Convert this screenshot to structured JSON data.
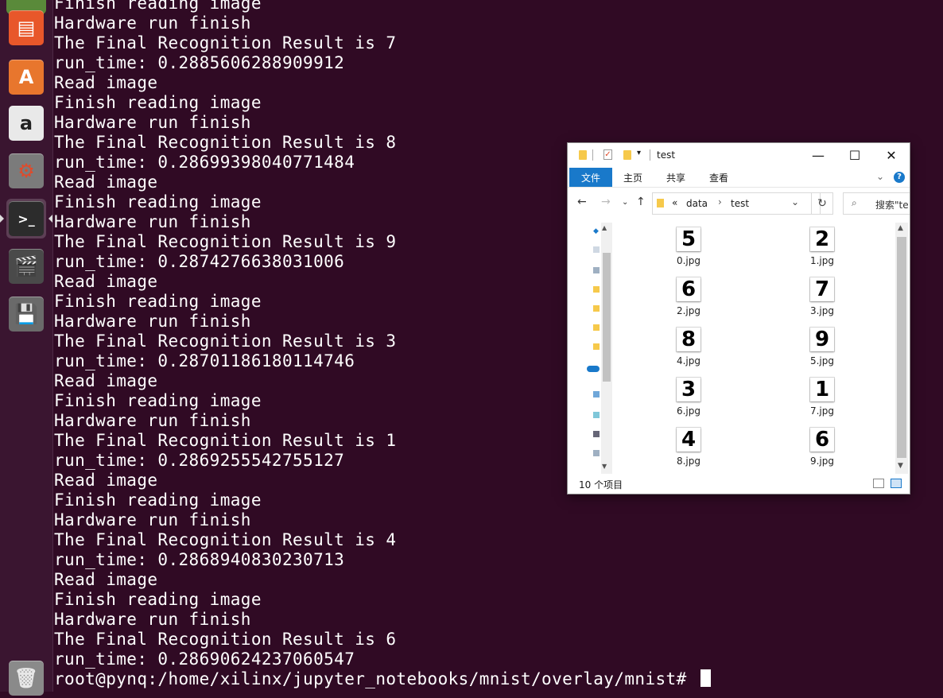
{
  "terminal": {
    "lines": [
      "Finish reading image",
      "Hardware run finish",
      "The Final Recognition Result is 7",
      "run_time: 0.2885606288909912",
      "Read image",
      "Finish reading image",
      "Hardware run finish",
      "The Final Recognition Result is 8",
      "run_time: 0.28699398040771484",
      "Read image",
      "Finish reading image",
      "Hardware run finish",
      "The Final Recognition Result is 9",
      "run_time: 0.2874276638031006",
      "Read image",
      "Finish reading image",
      "Hardware run finish",
      "The Final Recognition Result is 3",
      "run_time: 0.28701186180114746",
      "Read image",
      "Finish reading image",
      "Hardware run finish",
      "The Final Recognition Result is 1",
      "run_time: 0.2869255542755127",
      "Read image",
      "Finish reading image",
      "Hardware run finish",
      "The Final Recognition Result is 4",
      "run_time: 0.2868940830230713",
      "Read image",
      "Finish reading image",
      "Hardware run finish",
      "The Final Recognition Result is 6",
      "run_time: 0.28690624237060547"
    ],
    "prompt": "root@pynq:/home/xilinx/jupyter_notebooks/mnist/overlay/mnist# "
  },
  "launcher": {
    "items": [
      {
        "name": "presentation-app-icon",
        "glyph": "▤",
        "bg": "#e8572a",
        "fg": "#ffffff"
      },
      {
        "name": "software-center-icon",
        "glyph": "A",
        "bg": "#e8762d",
        "fg": "#ffffff"
      },
      {
        "name": "amazon-icon",
        "glyph": "a",
        "bg": "#e9e9e9",
        "fg": "#222222"
      },
      {
        "name": "system-settings-icon",
        "glyph": "⚙",
        "bg": "#7b7b7b",
        "fg": "#e04a2a"
      },
      {
        "name": "terminal-icon",
        "glyph": ">_",
        "bg": "#2c2c2c",
        "fg": "#ffffff"
      },
      {
        "name": "video-editor-icon",
        "glyph": "🎬",
        "bg": "#4a4a4a",
        "fg": "#ffffff"
      },
      {
        "name": "save-disk-icon",
        "glyph": "💾",
        "bg": "#6a6a6a",
        "fg": "#ffffff"
      }
    ],
    "trash_glyph": "🗑"
  },
  "explorer": {
    "title": "test",
    "ribbon_tabs": [
      "文件",
      "主页",
      "共享",
      "查看"
    ],
    "accent": "#1979ca",
    "path": [
      "data",
      "test"
    ],
    "path_prefix": "«",
    "search_placeholder": "搜索\"te",
    "files": [
      {
        "digit": "5",
        "name": "0.jpg"
      },
      {
        "digit": "2",
        "name": "1.jpg"
      },
      {
        "digit": "6",
        "name": "2.jpg"
      },
      {
        "digit": "7",
        "name": "3.jpg"
      },
      {
        "digit": "8",
        "name": "4.jpg"
      },
      {
        "digit": "9",
        "name": "5.jpg"
      },
      {
        "digit": "3",
        "name": "6.jpg"
      },
      {
        "digit": "1",
        "name": "7.jpg"
      },
      {
        "digit": "4",
        "name": "8.jpg"
      },
      {
        "digit": "6",
        "name": "9.jpg"
      }
    ],
    "status": "10 个项目",
    "controls": {
      "minimize": "—",
      "maximize": "☐",
      "close": "✕"
    }
  }
}
